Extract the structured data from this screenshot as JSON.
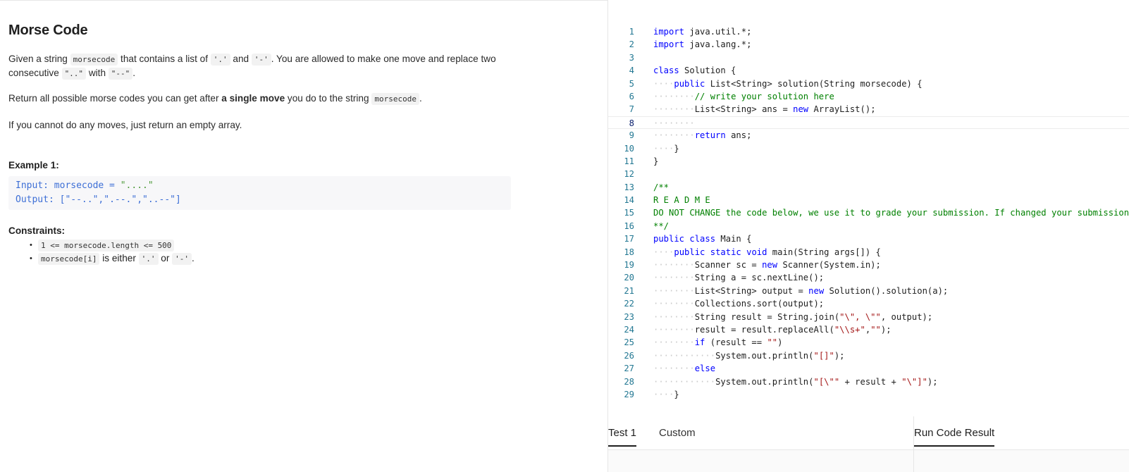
{
  "problem": {
    "title": "Morse Code",
    "p1_a": "Given a string ",
    "p1_code1": "morsecode",
    "p1_b": " that contains a list of ",
    "p1_code2": "'.'",
    "p1_c": " and ",
    "p1_code3": "'-'",
    "p1_d": ". You are allowed to make one move and replace two consecutive ",
    "p1_code4": "\"..\"",
    "p1_e": " with ",
    "p1_code5": "\"--\"",
    "p1_f": ".",
    "p2_a": "Return all possible morse codes you can get after ",
    "p2_bold": "a single move",
    "p2_b": " you do to the string ",
    "p2_code": "morsecode",
    "p2_c": ".",
    "p3": "If you cannot do any moves, just return an empty array.",
    "example_title": "Example 1:",
    "example_input_label": "Input: morsecode = ",
    "example_input_value": "\"....\"",
    "example_output_label": "Output: ",
    "example_output_value": "[\"--..\",\".--.\",\"..--\"]",
    "constraints_title": "Constraints:",
    "constraint1_code": "1 <= morsecode.length <= 500",
    "constraint2_code1": "morsecode[i]",
    "constraint2_a": " is either ",
    "constraint2_code2": "'.'",
    "constraint2_b": " or ",
    "constraint2_code3": "'-'",
    "constraint2_c": "."
  },
  "editor": {
    "current_line": 8,
    "lines": [
      {
        "n": "1",
        "indent": 0,
        "toks": [
          [
            "kw",
            "import"
          ],
          [
            "p",
            " java.util.*;"
          ]
        ]
      },
      {
        "n": "2",
        "indent": 0,
        "toks": [
          [
            "kw",
            "import"
          ],
          [
            "p",
            " java.lang.*;"
          ]
        ]
      },
      {
        "n": "3",
        "indent": 0,
        "toks": []
      },
      {
        "n": "4",
        "indent": 0,
        "toks": [
          [
            "kw",
            "class"
          ],
          [
            "p",
            " Solution {"
          ]
        ]
      },
      {
        "n": "5",
        "indent": 1,
        "toks": [
          [
            "kw",
            "public"
          ],
          [
            "p",
            " List<String> solution(String morsecode) {"
          ]
        ]
      },
      {
        "n": "6",
        "indent": 2,
        "toks": [
          [
            "cm",
            "// write your solution here"
          ]
        ]
      },
      {
        "n": "7",
        "indent": 2,
        "toks": [
          [
            "p",
            "List<String> ans = "
          ],
          [
            "kw",
            "new"
          ],
          [
            "p",
            " ArrayList();"
          ]
        ]
      },
      {
        "n": "8",
        "indent": 2,
        "toks": []
      },
      {
        "n": "9",
        "indent": 2,
        "toks": [
          [
            "kw",
            "return"
          ],
          [
            "p",
            " ans;"
          ]
        ]
      },
      {
        "n": "10",
        "indent": 1,
        "toks": [
          [
            "p",
            "}"
          ]
        ]
      },
      {
        "n": "11",
        "indent": 0,
        "toks": [
          [
            "p",
            "}"
          ]
        ]
      },
      {
        "n": "12",
        "indent": 0,
        "toks": []
      },
      {
        "n": "13",
        "indent": 0,
        "toks": [
          [
            "cm",
            "/**"
          ]
        ]
      },
      {
        "n": "14",
        "indent": 0,
        "toks": [
          [
            "cm",
            "R E A D M E"
          ]
        ]
      },
      {
        "n": "15",
        "indent": 0,
        "toks": [
          [
            "cm",
            "DO NOT CHANGE the code below, we use it to grade your submission. If changed your submission"
          ]
        ]
      },
      {
        "n": "16",
        "indent": 0,
        "toks": [
          [
            "cm",
            "**/"
          ]
        ]
      },
      {
        "n": "17",
        "indent": 0,
        "toks": [
          [
            "kw",
            "public"
          ],
          [
            "p",
            " "
          ],
          [
            "kw",
            "class"
          ],
          [
            "p",
            " Main {"
          ]
        ]
      },
      {
        "n": "18",
        "indent": 1,
        "toks": [
          [
            "kw",
            "public"
          ],
          [
            "p",
            " "
          ],
          [
            "kw",
            "static"
          ],
          [
            "p",
            " "
          ],
          [
            "kw",
            "void"
          ],
          [
            "p",
            " main(String args[]) {"
          ]
        ]
      },
      {
        "n": "19",
        "indent": 2,
        "toks": [
          [
            "p",
            "Scanner sc = "
          ],
          [
            "kw",
            "new"
          ],
          [
            "p",
            " Scanner(System.in);"
          ]
        ]
      },
      {
        "n": "20",
        "indent": 2,
        "toks": [
          [
            "p",
            "String a = sc.nextLine();"
          ]
        ]
      },
      {
        "n": "21",
        "indent": 2,
        "toks": [
          [
            "p",
            "List<String> output = "
          ],
          [
            "kw",
            "new"
          ],
          [
            "p",
            " Solution().solution(a);"
          ]
        ]
      },
      {
        "n": "22",
        "indent": 2,
        "toks": [
          [
            "p",
            "Collections.sort(output);"
          ]
        ]
      },
      {
        "n": "23",
        "indent": 2,
        "toks": [
          [
            "p",
            "String result = String.join("
          ],
          [
            "st",
            "\"\\\", \\\"\""
          ],
          [
            "p",
            ", output);"
          ]
        ]
      },
      {
        "n": "24",
        "indent": 2,
        "toks": [
          [
            "p",
            "result = result.replaceAll("
          ],
          [
            "st",
            "\"\\\\s+\""
          ],
          [
            "p",
            ","
          ],
          [
            "st",
            "\"\""
          ],
          [
            "p",
            ");"
          ]
        ]
      },
      {
        "n": "25",
        "indent": 2,
        "toks": [
          [
            "kw",
            "if"
          ],
          [
            "p",
            " (result == "
          ],
          [
            "st",
            "\"\""
          ],
          [
            "p",
            ")"
          ]
        ]
      },
      {
        "n": "26",
        "indent": 3,
        "toks": [
          [
            "p",
            "System.out.println("
          ],
          [
            "st",
            "\"[]\""
          ],
          [
            "p",
            ");"
          ]
        ]
      },
      {
        "n": "27",
        "indent": 2,
        "toks": [
          [
            "kw",
            "else"
          ]
        ]
      },
      {
        "n": "28",
        "indent": 3,
        "toks": [
          [
            "p",
            "System.out.println("
          ],
          [
            "st",
            "\"[\\\"\""
          ],
          [
            "p",
            " + result + "
          ],
          [
            "st",
            "\"\\\"]\""
          ],
          [
            "p",
            ");"
          ]
        ]
      },
      {
        "n": "29",
        "indent": 1,
        "toks": [
          [
            "p",
            "}"
          ]
        ]
      }
    ]
  },
  "tabs": {
    "test1": "Test 1",
    "custom": "Custom",
    "run_result": "Run Code Result"
  }
}
